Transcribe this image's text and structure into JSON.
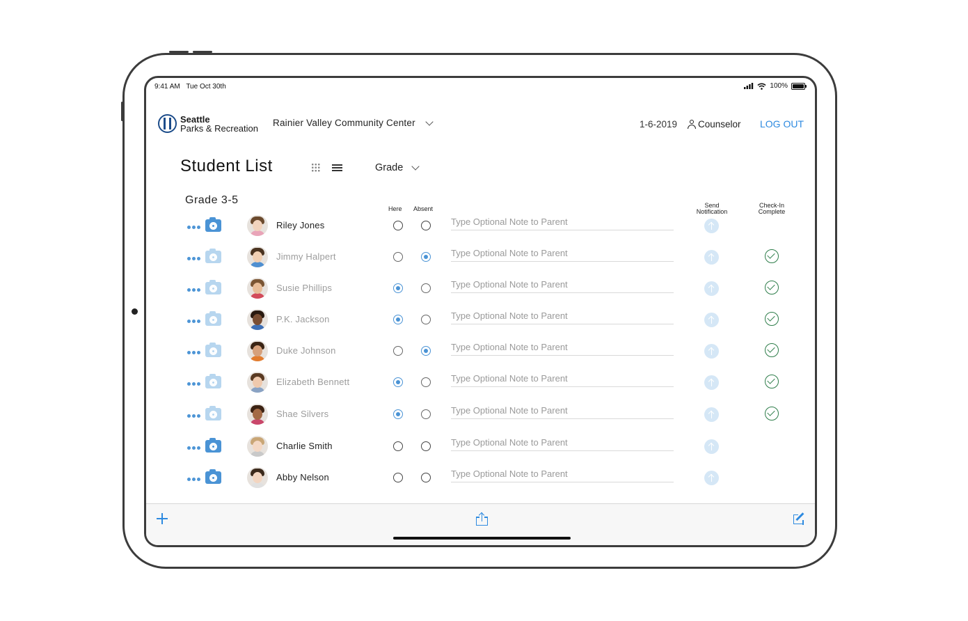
{
  "status_bar": {
    "time": "9:41 AM",
    "date": "Tue Oct 30th",
    "battery": "100%"
  },
  "header": {
    "logo_line1": "Seattle",
    "logo_line2": "Parks & Recreation",
    "location": "Rainier Valley Community Center",
    "date": "1-6-2019",
    "user_role": "Counselor",
    "logout_label": "LOG OUT"
  },
  "page": {
    "title": "Student List",
    "group_by": "Grade"
  },
  "section": {
    "title": "Grade 3-5"
  },
  "columns": {
    "here": "Here",
    "absent": "Absent",
    "send_line1": "Send",
    "send_line2": "Notification",
    "check_line1": "Check-In",
    "check_line2": "Complete"
  },
  "note_placeholder": "Type Optional Note to Parent",
  "students": [
    {
      "name": "Riley Jones",
      "attendance": "none",
      "checked_in": false
    },
    {
      "name": "Jimmy Halpert",
      "attendance": "absent",
      "checked_in": true
    },
    {
      "name": "Susie Phillips",
      "attendance": "here",
      "checked_in": true
    },
    {
      "name": "P.K. Jackson",
      "attendance": "here",
      "checked_in": true
    },
    {
      "name": "Duke Johnson",
      "attendance": "absent",
      "checked_in": true
    },
    {
      "name": "Elizabeth Bennett",
      "attendance": "here",
      "checked_in": true
    },
    {
      "name": "Shae Silvers",
      "attendance": "here",
      "checked_in": true
    },
    {
      "name": "Charlie Smith",
      "attendance": "none",
      "checked_in": false
    },
    {
      "name": "Abby Nelson",
      "attendance": "none",
      "checked_in": false
    }
  ],
  "colors": {
    "accent": "#2d8ae0",
    "radio_selected": "#4a93d5",
    "check_green": "#2e7d4a",
    "logo_blue": "#1c4c8a"
  },
  "icons": {
    "toolbar_left": "plus-icon",
    "toolbar_center": "share-icon",
    "toolbar_right": "compose-icon",
    "view_grid": "grid-icon",
    "view_list": "list-icon"
  }
}
